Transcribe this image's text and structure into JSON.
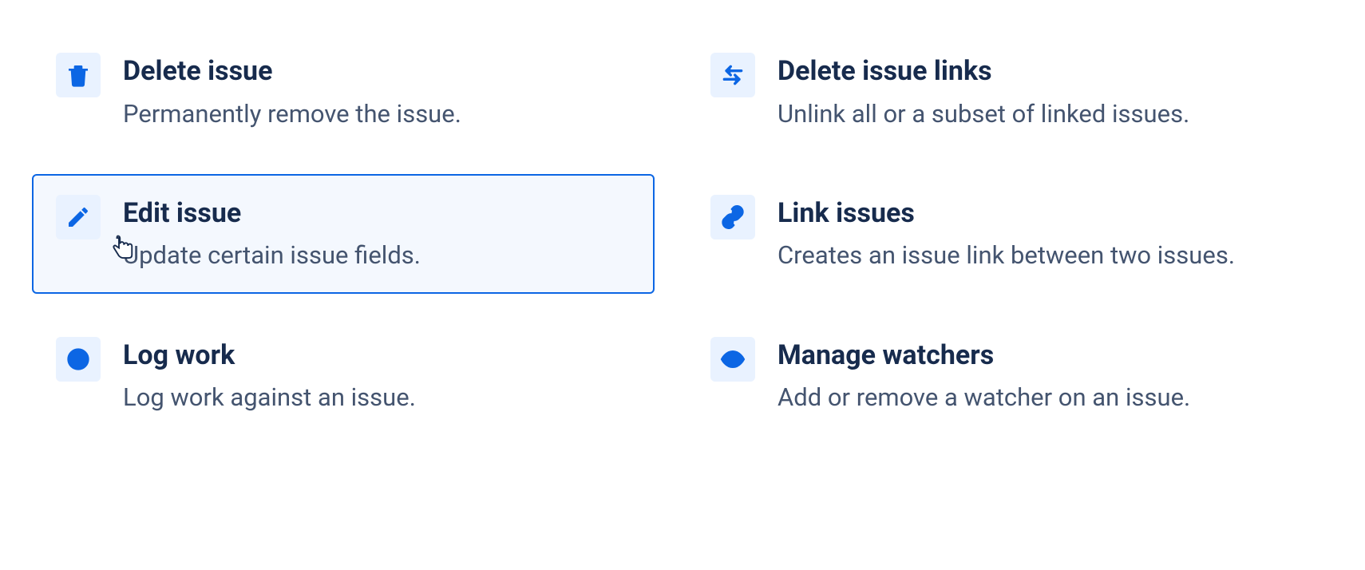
{
  "actions": {
    "deleteIssue": {
      "title": "Delete issue",
      "desc": "Permanently remove the issue."
    },
    "deleteIssueLinks": {
      "title": "Delete issue links",
      "desc": "Unlink all or a subset of linked issues."
    },
    "editIssue": {
      "title": "Edit issue",
      "desc": "Update certain issue fields."
    },
    "linkIssues": {
      "title": "Link issues",
      "desc": "Creates an issue link between two issues."
    },
    "logWork": {
      "title": "Log work",
      "desc": "Log work against an issue."
    },
    "manageWatchers": {
      "title": "Manage watchers",
      "desc": "Add or remove a watcher on an issue."
    }
  }
}
